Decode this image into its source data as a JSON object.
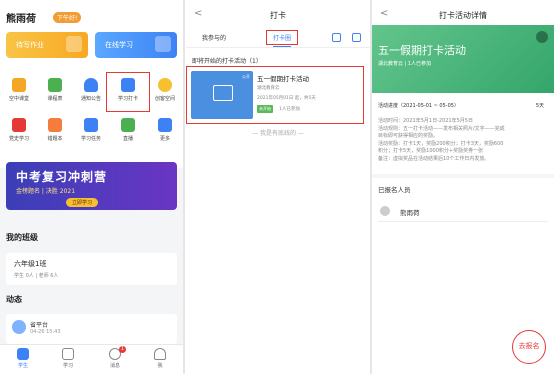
{
  "home": {
    "user_name": "熊雨荷",
    "greeting": "下午好!",
    "cards": [
      "待写作业",
      "在线学习"
    ],
    "grid": [
      {
        "label": "空中课堂",
        "color": "#f5a623"
      },
      {
        "label": "课程表",
        "color": "#4caf50"
      },
      {
        "label": "通知公告",
        "color": "#3c82f5"
      },
      {
        "label": "学习打卡",
        "color": "#3c82f5"
      },
      {
        "label": "创客空间",
        "color": "#f7c030"
      },
      {
        "label": "党史学习",
        "color": "#e53935"
      },
      {
        "label": "错题本",
        "color": "#f57c3a"
      },
      {
        "label": "学习任务",
        "color": "#3c82f5"
      },
      {
        "label": "直播",
        "color": "#4caf50"
      },
      {
        "label": "更多",
        "color": "#3c82f5"
      }
    ],
    "banner": {
      "title": "中考复习冲刺营",
      "subtitle": "金榜题名 | 决胜 2021",
      "button": "立即学习"
    },
    "my_class_title": "我的班级",
    "class": {
      "name": "六年级1班",
      "meta": "学生 0人 | 老师 6人"
    },
    "feed_title": "动态",
    "feed": {
      "name": "省平台",
      "time": "04-26 15:43"
    },
    "tabbar": [
      {
        "label": "学生",
        "active": true,
        "badge": ""
      },
      {
        "label": "学习",
        "active": false,
        "badge": ""
      },
      {
        "label": "消息",
        "active": false,
        "badge": "1"
      },
      {
        "label": "我",
        "active": false,
        "badge": ""
      }
    ]
  },
  "checkin": {
    "back": "<",
    "title": "打卡",
    "tab_mine": "我参与的",
    "tab_square": "打卡圈",
    "section": "即将开始的打卡活动（1）",
    "activity": {
      "title": "五一假期打卡活动",
      "org": "湖北教育云",
      "date": "2021年05月01日 起，共5天",
      "status": "未开始",
      "people": "1人已参加",
      "tag": "公开"
    },
    "end_text": "— 我是有底线的 —"
  },
  "detail": {
    "back": "<",
    "title": "打卡活动详情",
    "hero_title": "五一假期打卡活动",
    "hero_meta": "湖北教育云 | 1人已参加",
    "progress_label": "活动进度（2021-05-01 ~ 05-05）",
    "progress_days": "5天",
    "info_lines": [
      "活动时间：2021年5月1日-2021年5月5日",
      "活动规则：五一打卡活动——发布相关照片/文字——完成",
      "目标即可获得相应的奖励。",
      "活动奖励：打卡1天，奖励200积分；打卡3天，奖励600",
      "积分；打卡5天，奖励1000积分+奖励奖券一张",
      "备注：虚拟奖品在活动结果后10个工作日内发放。"
    ],
    "registered_title": "已报名人员",
    "person": "熊雨荷",
    "signup_button": "去报名"
  }
}
